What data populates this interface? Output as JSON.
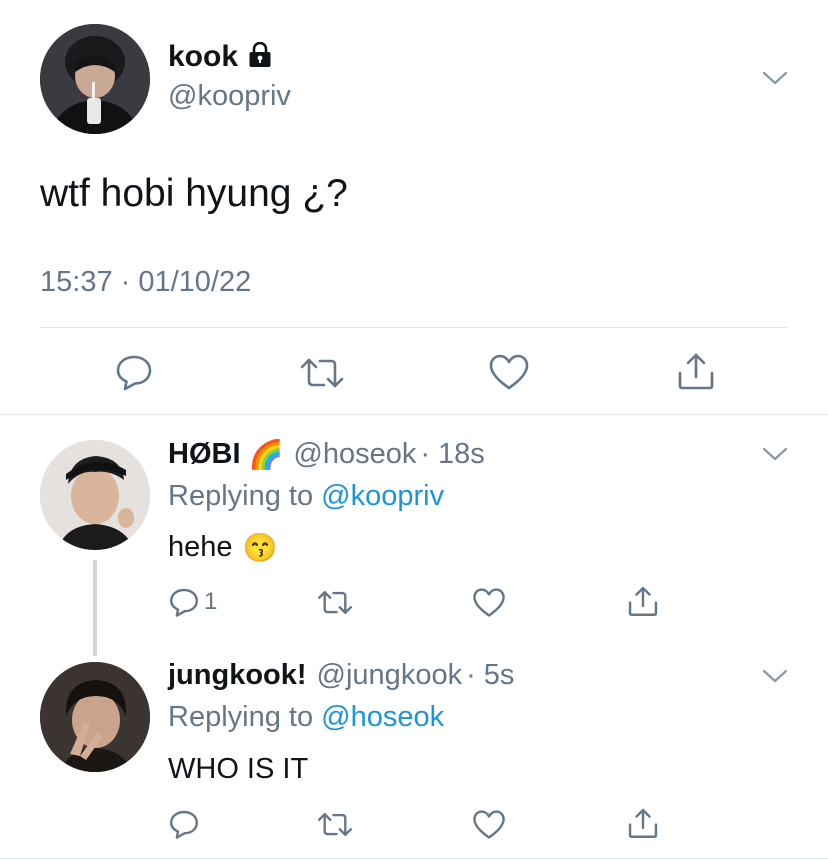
{
  "main_tweet": {
    "display_name": "kook",
    "handle": "@koopriv",
    "text": "wtf hobi hyung ¿?",
    "timestamp": "15:37 · 01/10/22",
    "protected_icon": "lock-icon"
  },
  "replies": [
    {
      "display_name": "HØBI",
      "name_emoji": "🌈",
      "handle": "@hoseok",
      "age": "· 18s",
      "replying_label": "Replying to",
      "replying_to": "@koopriv",
      "text": "hehe",
      "text_emoji": "😙",
      "reply_count": "1"
    },
    {
      "display_name": "jungkook!",
      "handle": "@jungkook",
      "age": "· 5s",
      "replying_label": "Replying to",
      "replying_to": "@hoseok",
      "text": "WHO IS IT"
    }
  ],
  "icons": {
    "reply": "speech-bubble-icon",
    "retweet": "retweet-icon",
    "like": "heart-icon",
    "share": "share-icon",
    "menu": "chevron-down-icon"
  },
  "colors": {
    "text": "#0f1419",
    "secondary": "#657786",
    "link": "#1b95e0",
    "divider": "#e1e8ed"
  }
}
